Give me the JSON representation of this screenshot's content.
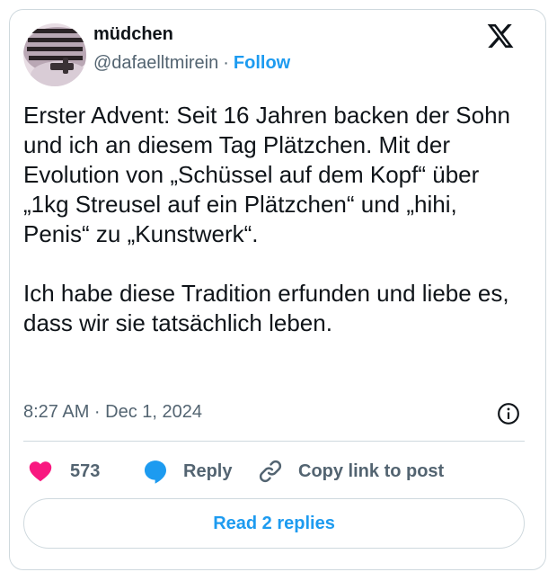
{
  "author": {
    "display_name": "müdchen",
    "handle": "@dafaelltmirein",
    "separator": "·",
    "follow_label": "Follow"
  },
  "logo_icon": "x-logo-icon",
  "tweet": {
    "paragraphs": [
      "Erster Advent: Seit 16 Jahren backen der Sohn und ich an diesem Tag Plätzchen. Mit der Evolution von „Schüssel auf dem Kopf“ über „1kg Streusel auf ein Plätzchen“ und „hihi, Penis“ zu „Kunstwerk“.",
      "Ich habe diese Tradition erfunden und liebe es, dass wir sie tatsächlich leben."
    ],
    "timestamp": "8:27 AM · Dec 1, 2024"
  },
  "actions": {
    "like_count": "573",
    "reply_label": "Reply",
    "copy_link_label": "Copy link to post"
  },
  "read_replies_label": "Read 2 replies",
  "colors": {
    "accent": "#1d9bf0",
    "like": "#f91880",
    "text": "#0f1419",
    "secondary": "#536471",
    "border": "#cfd9de"
  }
}
